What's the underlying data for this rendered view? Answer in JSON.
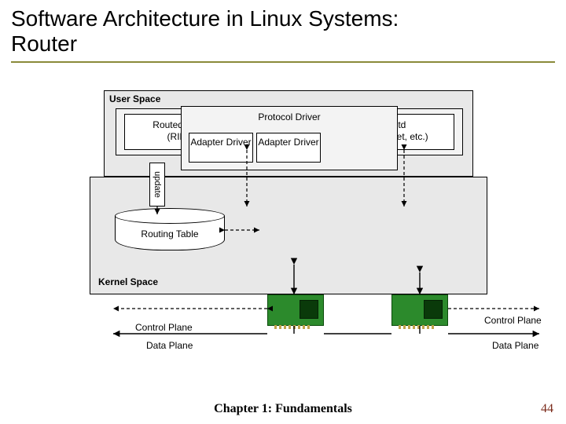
{
  "title_line1": "Software Architecture in Linux Systems:",
  "title_line2": "Router",
  "userspace": {
    "label": "User Space",
    "routed_line1": "Routed (RIP) / gated or zebra",
    "routed_line2": "(RIP, OSPF, BGP, etc.)",
    "inetd_line1": "Inetd",
    "inetd_line2": "(ftp, telnet, etc.)"
  },
  "kernel": {
    "label": "Kernel Space",
    "protocol_driver": "Protocol Driver",
    "adapter1": "Adapter Driver",
    "adapter2": "Adapter Driver"
  },
  "routing_table": "Routing Table",
  "update": "update",
  "planes": {
    "control_left": "Control Plane",
    "control_right": "Control Plane",
    "data_left": "Data Plane",
    "data_right": "Data Plane"
  },
  "footer": {
    "chapter": "Chapter 1: Fundamentals",
    "page": "44"
  }
}
